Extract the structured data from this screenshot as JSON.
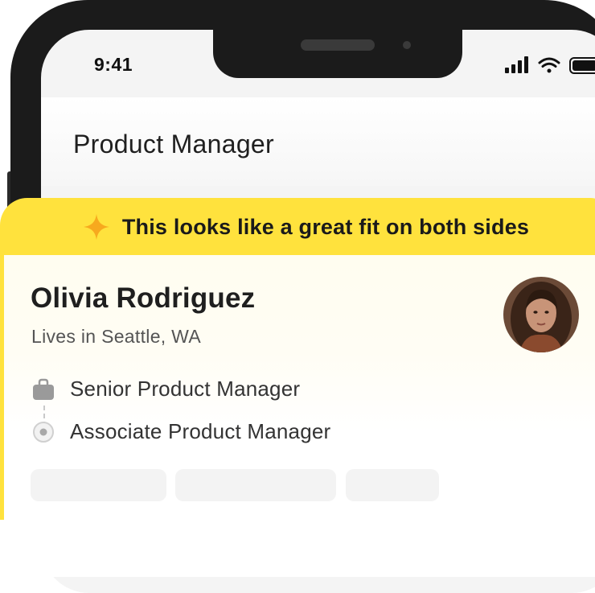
{
  "status_bar": {
    "time": "9:41",
    "icons": [
      "cellular-signal-icon",
      "wifi-icon",
      "battery-icon"
    ]
  },
  "header": {
    "title": "Product Manager"
  },
  "match_card": {
    "banner_icon": "sparkle-icon",
    "banner_text": "This looks like a great fit on both sides",
    "accent_color": "#ffe23d",
    "candidate": {
      "name": "Olivia Rodriguez",
      "location": "Lives in Seattle, WA",
      "roles": [
        {
          "icon": "briefcase-icon",
          "label": "Senior Product Manager"
        },
        {
          "icon": "radio-dot-icon",
          "label": "Associate Product Manager"
        }
      ]
    }
  }
}
